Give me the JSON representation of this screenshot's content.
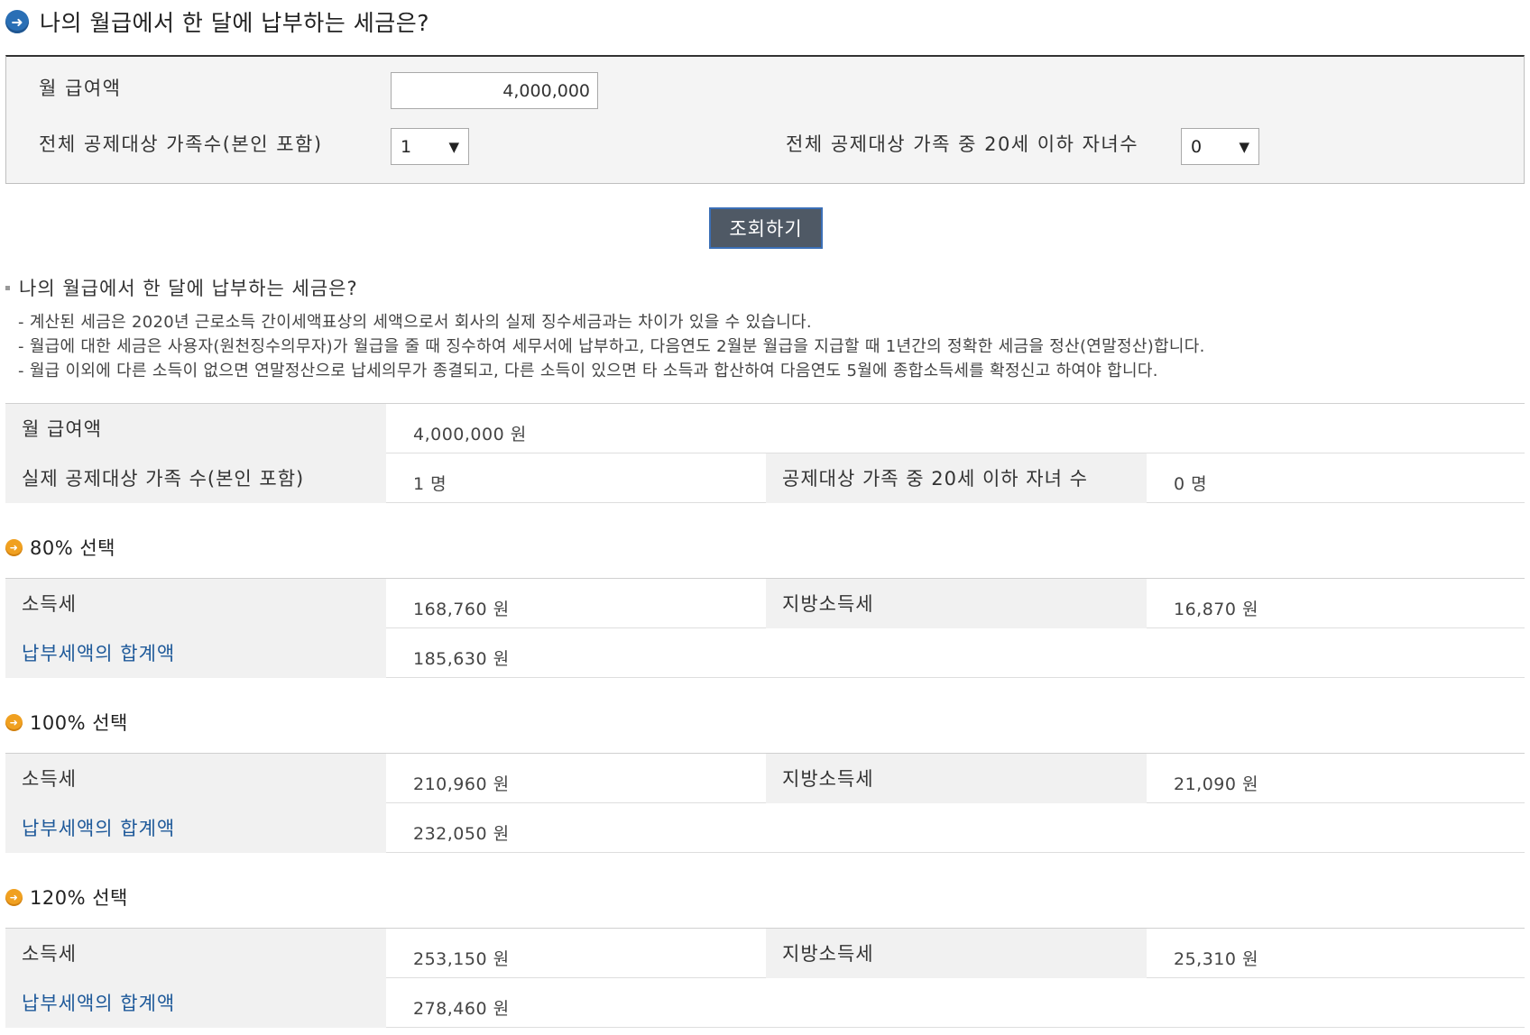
{
  "page": {
    "title": "나의 월급에서 한 달에 납부하는 세금은?"
  },
  "form": {
    "salary_label": "월 급여액",
    "salary_value": "4,000,000",
    "family_label": "전체 공제대상 가족수(본인 포함)",
    "family_value": "1",
    "children_label": "전체 공제대상 가족 중 20세 이하 자녀수",
    "children_value": "0",
    "select_arrow": "▼",
    "search_button": "조회하기"
  },
  "notice": {
    "title": "나의 월급에서 한 달에 납부하는 세금은?",
    "lines": [
      "- 계산된 세금은  2020년  근로소득 간이세액표상의 세액으로서 회사의 실제 징수세금과는 차이가 있을 수 있습니다.",
      "- 월급에 대한 세금은 사용자(원천징수의무자)가 월급을 줄 때 징수하여 세무서에 납부하고, 다음연도 2월분 월급을 지급할 때 1년간의 정확한 세금을 정산(연말정산)합니다.",
      "- 월급 이외에 다른 소득이 없으면 연말정산으로 납세의무가 종결되고, 다른 소득이 있으면 타 소득과 합산하여 다음연도 5월에 종합소득세를 확정신고 하여야 합니다."
    ]
  },
  "summary": {
    "salary_label": "월 급여액",
    "salary_value": "4,000,000  원",
    "family_label": "실제 공제대상 가족 수(본인 포함)",
    "family_value": "1  명",
    "children_label": "공제대상 가족 중 20세 이하 자녀 수",
    "children_value": "0  명"
  },
  "sections": [
    {
      "title": "80% 선택",
      "income_tax_label": "소득세",
      "income_tax_value": "168,760  원",
      "local_tax_label": "지방소득세",
      "local_tax_value": "16,870  원",
      "total_label": "납부세액의 합계액",
      "total_value": "185,630  원"
    },
    {
      "title": "100% 선택",
      "income_tax_label": "소득세",
      "income_tax_value": "210,960  원",
      "local_tax_label": "지방소득세",
      "local_tax_value": "21,090  원",
      "total_label": "납부세액의 합계액",
      "total_value": "232,050  원"
    },
    {
      "title": "120% 선택",
      "income_tax_label": "소득세",
      "income_tax_value": "253,150  원",
      "local_tax_label": "지방소득세",
      "local_tax_value": "25,310  원",
      "total_label": "납부세액의 합계액",
      "total_value": "278,460  원"
    }
  ],
  "icons": {
    "title_icon": "arrow-right-circle-icon",
    "section_icon": "arrow-right-circle-icon",
    "title_glyph": "➜",
    "section_glyph": "➜"
  },
  "colors": {
    "title_icon": "#2a6fb5",
    "section_icon": "#f0a020",
    "button_bg": "#4f5965",
    "link_label": "#1f5a9a"
  }
}
